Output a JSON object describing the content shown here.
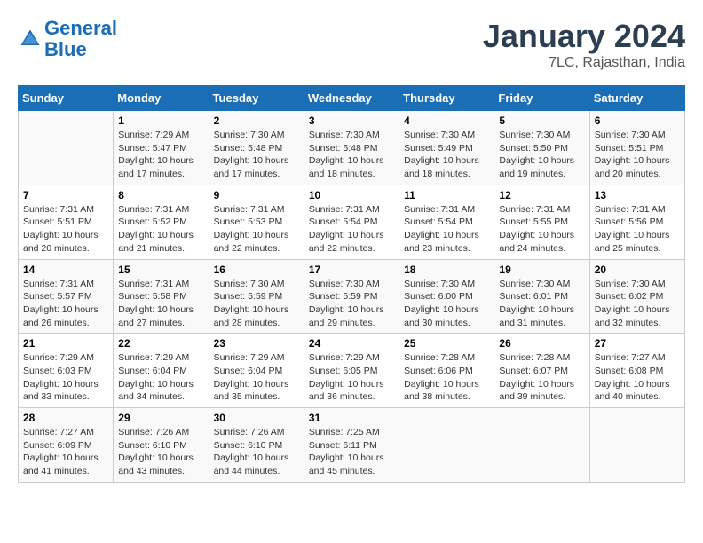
{
  "logo": {
    "line1": "General",
    "line2": "Blue"
  },
  "title": "January 2024",
  "subtitle": "7LC, Rajasthan, India",
  "days_of_week": [
    "Sunday",
    "Monday",
    "Tuesday",
    "Wednesday",
    "Thursday",
    "Friday",
    "Saturday"
  ],
  "weeks": [
    [
      {
        "day": "",
        "sunrise": "",
        "sunset": "",
        "daylight": ""
      },
      {
        "day": "1",
        "sunrise": "Sunrise: 7:29 AM",
        "sunset": "Sunset: 5:47 PM",
        "daylight": "Daylight: 10 hours and 17 minutes."
      },
      {
        "day": "2",
        "sunrise": "Sunrise: 7:30 AM",
        "sunset": "Sunset: 5:48 PM",
        "daylight": "Daylight: 10 hours and 17 minutes."
      },
      {
        "day": "3",
        "sunrise": "Sunrise: 7:30 AM",
        "sunset": "Sunset: 5:48 PM",
        "daylight": "Daylight: 10 hours and 18 minutes."
      },
      {
        "day": "4",
        "sunrise": "Sunrise: 7:30 AM",
        "sunset": "Sunset: 5:49 PM",
        "daylight": "Daylight: 10 hours and 18 minutes."
      },
      {
        "day": "5",
        "sunrise": "Sunrise: 7:30 AM",
        "sunset": "Sunset: 5:50 PM",
        "daylight": "Daylight: 10 hours and 19 minutes."
      },
      {
        "day": "6",
        "sunrise": "Sunrise: 7:30 AM",
        "sunset": "Sunset: 5:51 PM",
        "daylight": "Daylight: 10 hours and 20 minutes."
      }
    ],
    [
      {
        "day": "7",
        "sunrise": "Sunrise: 7:31 AM",
        "sunset": "Sunset: 5:51 PM",
        "daylight": "Daylight: 10 hours and 20 minutes."
      },
      {
        "day": "8",
        "sunrise": "Sunrise: 7:31 AM",
        "sunset": "Sunset: 5:52 PM",
        "daylight": "Daylight: 10 hours and 21 minutes."
      },
      {
        "day": "9",
        "sunrise": "Sunrise: 7:31 AM",
        "sunset": "Sunset: 5:53 PM",
        "daylight": "Daylight: 10 hours and 22 minutes."
      },
      {
        "day": "10",
        "sunrise": "Sunrise: 7:31 AM",
        "sunset": "Sunset: 5:54 PM",
        "daylight": "Daylight: 10 hours and 22 minutes."
      },
      {
        "day": "11",
        "sunrise": "Sunrise: 7:31 AM",
        "sunset": "Sunset: 5:54 PM",
        "daylight": "Daylight: 10 hours and 23 minutes."
      },
      {
        "day": "12",
        "sunrise": "Sunrise: 7:31 AM",
        "sunset": "Sunset: 5:55 PM",
        "daylight": "Daylight: 10 hours and 24 minutes."
      },
      {
        "day": "13",
        "sunrise": "Sunrise: 7:31 AM",
        "sunset": "Sunset: 5:56 PM",
        "daylight": "Daylight: 10 hours and 25 minutes."
      }
    ],
    [
      {
        "day": "14",
        "sunrise": "Sunrise: 7:31 AM",
        "sunset": "Sunset: 5:57 PM",
        "daylight": "Daylight: 10 hours and 26 minutes."
      },
      {
        "day": "15",
        "sunrise": "Sunrise: 7:31 AM",
        "sunset": "Sunset: 5:58 PM",
        "daylight": "Daylight: 10 hours and 27 minutes."
      },
      {
        "day": "16",
        "sunrise": "Sunrise: 7:30 AM",
        "sunset": "Sunset: 5:59 PM",
        "daylight": "Daylight: 10 hours and 28 minutes."
      },
      {
        "day": "17",
        "sunrise": "Sunrise: 7:30 AM",
        "sunset": "Sunset: 5:59 PM",
        "daylight": "Daylight: 10 hours and 29 minutes."
      },
      {
        "day": "18",
        "sunrise": "Sunrise: 7:30 AM",
        "sunset": "Sunset: 6:00 PM",
        "daylight": "Daylight: 10 hours and 30 minutes."
      },
      {
        "day": "19",
        "sunrise": "Sunrise: 7:30 AM",
        "sunset": "Sunset: 6:01 PM",
        "daylight": "Daylight: 10 hours and 31 minutes."
      },
      {
        "day": "20",
        "sunrise": "Sunrise: 7:30 AM",
        "sunset": "Sunset: 6:02 PM",
        "daylight": "Daylight: 10 hours and 32 minutes."
      }
    ],
    [
      {
        "day": "21",
        "sunrise": "Sunrise: 7:29 AM",
        "sunset": "Sunset: 6:03 PM",
        "daylight": "Daylight: 10 hours and 33 minutes."
      },
      {
        "day": "22",
        "sunrise": "Sunrise: 7:29 AM",
        "sunset": "Sunset: 6:04 PM",
        "daylight": "Daylight: 10 hours and 34 minutes."
      },
      {
        "day": "23",
        "sunrise": "Sunrise: 7:29 AM",
        "sunset": "Sunset: 6:04 PM",
        "daylight": "Daylight: 10 hours and 35 minutes."
      },
      {
        "day": "24",
        "sunrise": "Sunrise: 7:29 AM",
        "sunset": "Sunset: 6:05 PM",
        "daylight": "Daylight: 10 hours and 36 minutes."
      },
      {
        "day": "25",
        "sunrise": "Sunrise: 7:28 AM",
        "sunset": "Sunset: 6:06 PM",
        "daylight": "Daylight: 10 hours and 38 minutes."
      },
      {
        "day": "26",
        "sunrise": "Sunrise: 7:28 AM",
        "sunset": "Sunset: 6:07 PM",
        "daylight": "Daylight: 10 hours and 39 minutes."
      },
      {
        "day": "27",
        "sunrise": "Sunrise: 7:27 AM",
        "sunset": "Sunset: 6:08 PM",
        "daylight": "Daylight: 10 hours and 40 minutes."
      }
    ],
    [
      {
        "day": "28",
        "sunrise": "Sunrise: 7:27 AM",
        "sunset": "Sunset: 6:09 PM",
        "daylight": "Daylight: 10 hours and 41 minutes."
      },
      {
        "day": "29",
        "sunrise": "Sunrise: 7:26 AM",
        "sunset": "Sunset: 6:10 PM",
        "daylight": "Daylight: 10 hours and 43 minutes."
      },
      {
        "day": "30",
        "sunrise": "Sunrise: 7:26 AM",
        "sunset": "Sunset: 6:10 PM",
        "daylight": "Daylight: 10 hours and 44 minutes."
      },
      {
        "day": "31",
        "sunrise": "Sunrise: 7:25 AM",
        "sunset": "Sunset: 6:11 PM",
        "daylight": "Daylight: 10 hours and 45 minutes."
      },
      {
        "day": "",
        "sunrise": "",
        "sunset": "",
        "daylight": ""
      },
      {
        "day": "",
        "sunrise": "",
        "sunset": "",
        "daylight": ""
      },
      {
        "day": "",
        "sunrise": "",
        "sunset": "",
        "daylight": ""
      }
    ]
  ]
}
